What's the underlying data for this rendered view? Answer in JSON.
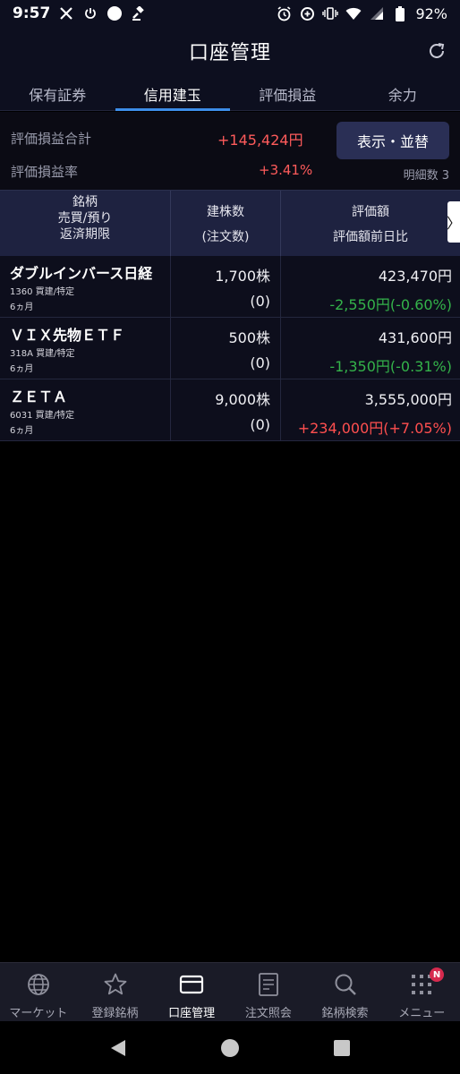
{
  "status_bar": {
    "time": "9:57",
    "battery": "92%"
  },
  "header": {
    "title": "口座管理"
  },
  "tabs": [
    {
      "label": "保有証券",
      "active": false
    },
    {
      "label": "信用建玉",
      "active": true
    },
    {
      "label": "評価損益",
      "active": false
    },
    {
      "label": "余力",
      "active": false
    }
  ],
  "summary": {
    "total_pl_label": "評価損益合計",
    "total_pl_value": "+145,424円",
    "pl_rate_label": "評価損益率",
    "pl_rate_value": "+3.41%",
    "display_button": "表示・並替",
    "detail_count": "明細数 3"
  },
  "table": {
    "headers": {
      "col1_line1": "銘柄",
      "col1_line2": "売買/預り",
      "col1_line3": "返済期限",
      "col2_line1": "建株数",
      "col2_line2": "(注文数)",
      "col3_line1": "評価額",
      "col3_line2": "評価額前日比"
    },
    "scroll_glyph": "〉",
    "rows": [
      {
        "name": "ダブルインバース日経",
        "sub": "1360 買建/特定",
        "term": "6ヵ月",
        "qty": "1,700株",
        "orders": "(0)",
        "value": "423,470円",
        "change": "-2,550円(-0.60%)",
        "change_dir": "neg"
      },
      {
        "name": "ＶＩＸ先物ＥＴＦ",
        "sub": "318A 買建/特定",
        "term": "6ヵ月",
        "qty": "500株",
        "orders": "(0)",
        "value": "431,600円",
        "change": "-1,350円(-0.31%)",
        "change_dir": "neg"
      },
      {
        "name": "ＺＥＴＡ",
        "sub": "6031 買建/特定",
        "term": "6ヵ月",
        "qty": "9,000株",
        "orders": "(0)",
        "value": "3,555,000円",
        "change": "+234,000円(+7.05%)",
        "change_dir": "pos"
      }
    ]
  },
  "bottom_nav": [
    {
      "label": "マーケット",
      "icon": "globe-icon",
      "active": false
    },
    {
      "label": "登録銘柄",
      "icon": "star-icon",
      "active": false
    },
    {
      "label": "口座管理",
      "icon": "card-icon",
      "active": true
    },
    {
      "label": "注文照会",
      "icon": "document-icon",
      "active": false
    },
    {
      "label": "銘柄検索",
      "icon": "search-icon",
      "active": false
    },
    {
      "label": "メニュー",
      "icon": "grid-icon",
      "active": false,
      "badge": "N"
    }
  ],
  "colors": {
    "positive": "#ff4f4f",
    "negative": "#34b34a",
    "accent": "#3d8de8"
  }
}
